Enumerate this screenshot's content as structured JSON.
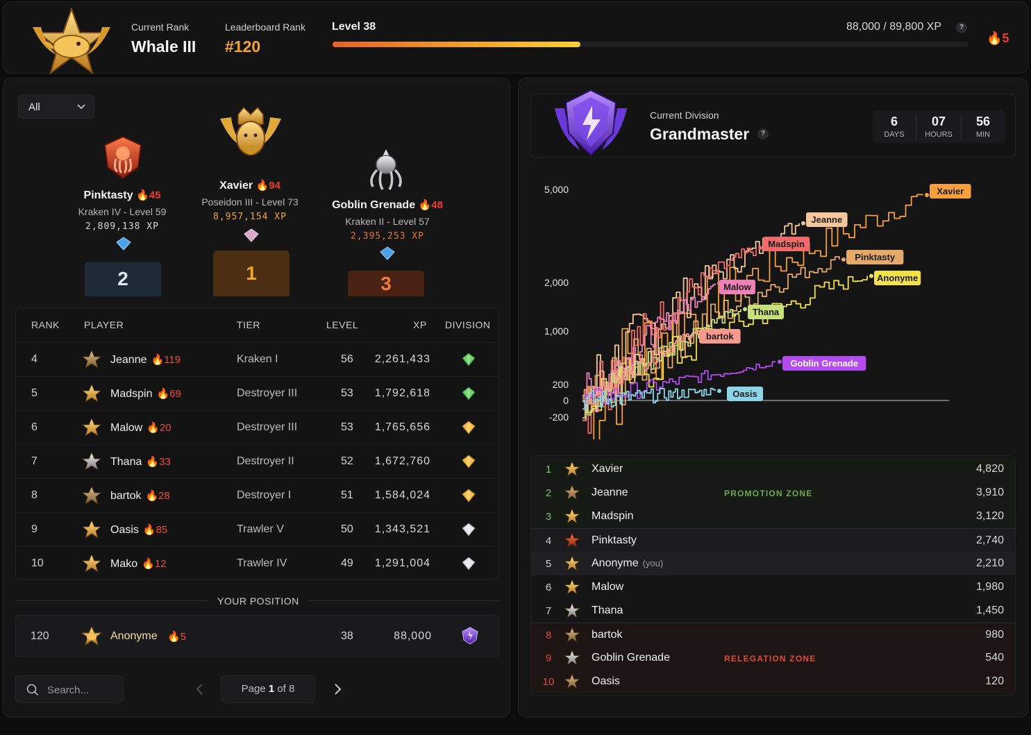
{
  "header": {
    "current_rank_label": "Current Rank",
    "current_rank_value": "Whale III",
    "leaderboard_rank_label": "Leaderboard Rank",
    "leaderboard_rank_value": "#120",
    "level_label": "Level 38",
    "xp_text": "88,000 / 89,800 XP",
    "xp_progress": 0.39,
    "help": "?",
    "streak": "5",
    "colors": {
      "accent": "#f2a52e",
      "streak": "#f03a2e"
    }
  },
  "filter": {
    "selected": "All"
  },
  "podium": [
    {
      "place": "2",
      "name": "Pinktasty",
      "streak": "45",
      "sub": "Kraken IV - Level 59",
      "xp": "2,809,138 XP",
      "badge": "kraken-red-badge"
    },
    {
      "place": "1",
      "name": "Xavier",
      "streak": "94",
      "sub": "Poseidon III - Level 73",
      "xp": "8,957,154 XP",
      "badge": "poseidon-gold-badge"
    },
    {
      "place": "3",
      "name": "Goblin Grenade",
      "streak": "48",
      "sub": "Kraken II - Level 57",
      "xp": "2,395,253 XP",
      "badge": "kraken-silver-badge"
    }
  ],
  "table": {
    "headers": {
      "rank": "RANK",
      "player": "PLAYER",
      "tier": "TIER",
      "level": "LEVEL",
      "xp": "XP",
      "division": "DIVISION"
    },
    "rows": [
      {
        "rank": "4",
        "name": "Jeanne",
        "streak": "119",
        "tier": "Kraken I",
        "level": "56",
        "xp": "2,261,433",
        "division": "green-gem-icon"
      },
      {
        "rank": "5",
        "name": "Madspin",
        "streak": "69",
        "tier": "Destroyer III",
        "level": "53",
        "xp": "1,792,618",
        "division": "green-gem-icon"
      },
      {
        "rank": "6",
        "name": "Malow",
        "streak": "20",
        "tier": "Destroyer III",
        "level": "53",
        "xp": "1,765,656",
        "division": "gold-gem-icon"
      },
      {
        "rank": "7",
        "name": "Thana",
        "streak": "33",
        "tier": "Destroyer II",
        "level": "52",
        "xp": "1,672,760",
        "division": "gold-gem-icon"
      },
      {
        "rank": "8",
        "name": "bartok",
        "streak": "28",
        "tier": "Destroyer I",
        "level": "51",
        "xp": "1,584,024",
        "division": "gold-gem-icon"
      },
      {
        "rank": "9",
        "name": "Oasis",
        "streak": "85",
        "tier": "Trawler V",
        "level": "50",
        "xp": "1,343,521",
        "division": "silver-gem-icon"
      },
      {
        "rank": "10",
        "name": "Mako",
        "streak": "12",
        "tier": "Trawler IV",
        "level": "49",
        "xp": "1,291,004",
        "division": "silver-gem-icon"
      }
    ]
  },
  "your_position": {
    "label": "YOUR POSITION",
    "rank": "120",
    "name": "Anonyme",
    "streak": "5",
    "level": "38",
    "xp": "88,000",
    "division": "purple-gem-icon"
  },
  "search": {
    "placeholder": "Search..."
  },
  "pagination": {
    "prefix": "Page",
    "current": "1",
    "suffix": "of 8"
  },
  "division": {
    "label": "Current Division",
    "name": "Grandmaster",
    "help": "?",
    "timer": [
      {
        "value": "6",
        "unit": "DAYS"
      },
      {
        "value": "07",
        "unit": "HOURS"
      },
      {
        "value": "56",
        "unit": "MIN"
      }
    ]
  },
  "chart_data": {
    "type": "line",
    "y_ticks": [
      "5,000",
      "2,000",
      "1,000",
      "200",
      "0",
      "-200"
    ],
    "series": [
      {
        "name": "Xavier",
        "color": "#f5a03c",
        "final": 4820
      },
      {
        "name": "Jeanne",
        "color": "#f6c79a",
        "final": 3910
      },
      {
        "name": "Madspin",
        "color": "#f16a6a",
        "final": 3120
      },
      {
        "name": "Pinktasty",
        "color": "#e5a96a",
        "final": 2740
      },
      {
        "name": "Anonyme",
        "color": "#f3e14a",
        "final": 2210
      },
      {
        "name": "Malow",
        "color": "#f080b8",
        "final": 1980
      },
      {
        "name": "Thana",
        "color": "#c8e07a",
        "final": 1450
      },
      {
        "name": "bartok",
        "color": "#f59a8c",
        "final": 980
      },
      {
        "name": "Goblin Grenade",
        "color": "#b34bf0",
        "final": 540
      },
      {
        "name": "Oasis",
        "color": "#8ad6e6",
        "final": 120
      }
    ]
  },
  "standings": {
    "promotion_label": "PROMOTION ZONE",
    "relegation_label": "RELEGATION ZONE",
    "you_label": "(you)",
    "rows": [
      {
        "pos": "1",
        "name": "Xavier",
        "pts": "4,820"
      },
      {
        "pos": "2",
        "name": "Jeanne",
        "pts": "3,910"
      },
      {
        "pos": "3",
        "name": "Madspin",
        "pts": "3,120"
      },
      {
        "pos": "4",
        "name": "Pinktasty",
        "pts": "2,740"
      },
      {
        "pos": "5",
        "name": "Anonyme",
        "pts": "2,210"
      },
      {
        "pos": "6",
        "name": "Malow",
        "pts": "1,980"
      },
      {
        "pos": "7",
        "name": "Thana",
        "pts": "1,450"
      },
      {
        "pos": "8",
        "name": "bartok",
        "pts": "980"
      },
      {
        "pos": "9",
        "name": "Goblin Grenade",
        "pts": "540"
      },
      {
        "pos": "10",
        "name": "Oasis",
        "pts": "120"
      }
    ]
  }
}
